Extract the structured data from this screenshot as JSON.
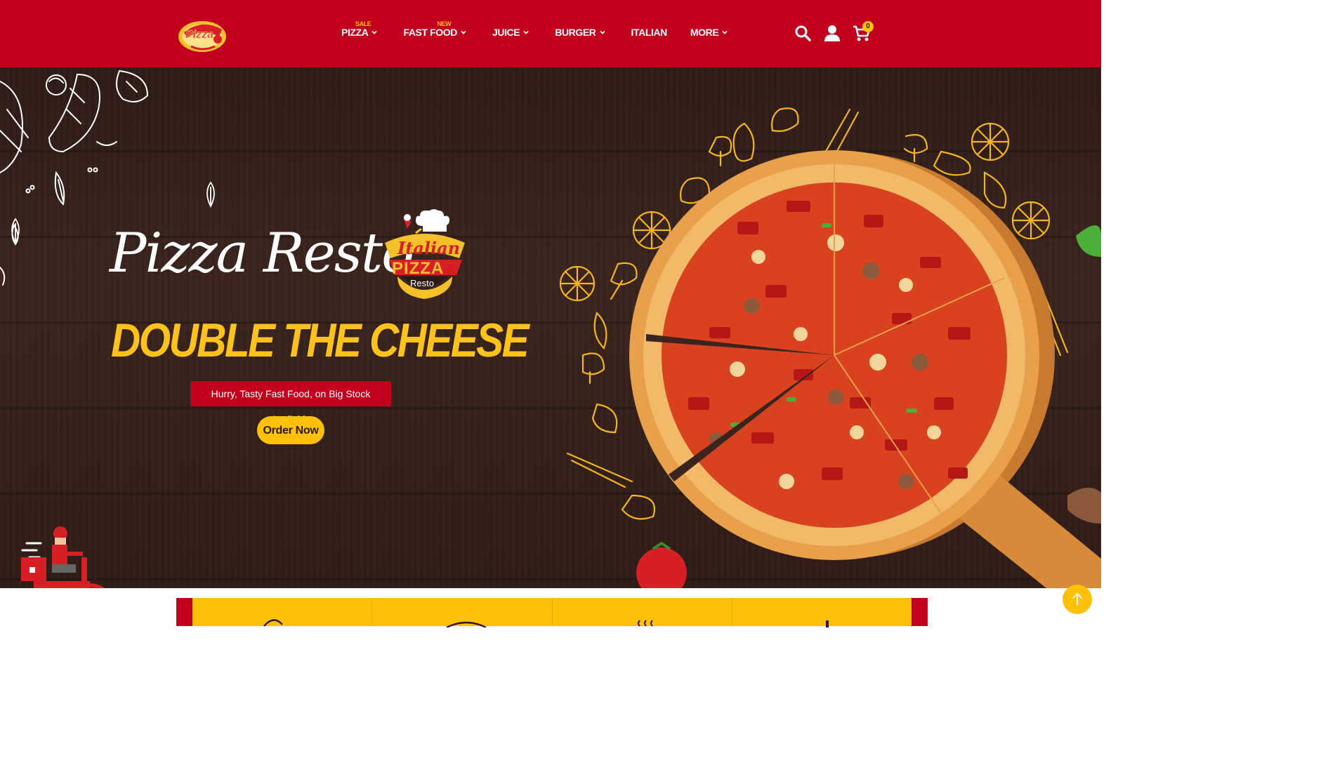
{
  "header": {
    "logo_alt": "Pizza",
    "nav": [
      {
        "label": "PIZZA",
        "badge": "SALE",
        "dropdown": true
      },
      {
        "label": "FAST FOOD",
        "badge": "NEW",
        "dropdown": true
      },
      {
        "label": "JUICE",
        "badge": "",
        "dropdown": true
      },
      {
        "label": "BURGER",
        "badge": "",
        "dropdown": true
      },
      {
        "label": "ITALIAN",
        "badge": "",
        "dropdown": false
      },
      {
        "label": "MORE",
        "badge": "",
        "dropdown": true
      }
    ],
    "icons": [
      "search-icon",
      "user-icon",
      "cart-icon"
    ],
    "cart_count": "0"
  },
  "hero": {
    "script_title": "Pizza Resto",
    "badge": {
      "line1": "Italian",
      "line2": "PIZZA",
      "line3": "Resto"
    },
    "headline": "DOUBLE THE CHEESE",
    "tagline": "Hurry, Tasty Fast Food, on Big Stock Available",
    "cta": "Order Now"
  },
  "features": {
    "count": 4
  },
  "colors": {
    "brand_red": "#c2001e",
    "accent_yellow": "#ffc107",
    "wood_dark": "#2e1b16"
  }
}
